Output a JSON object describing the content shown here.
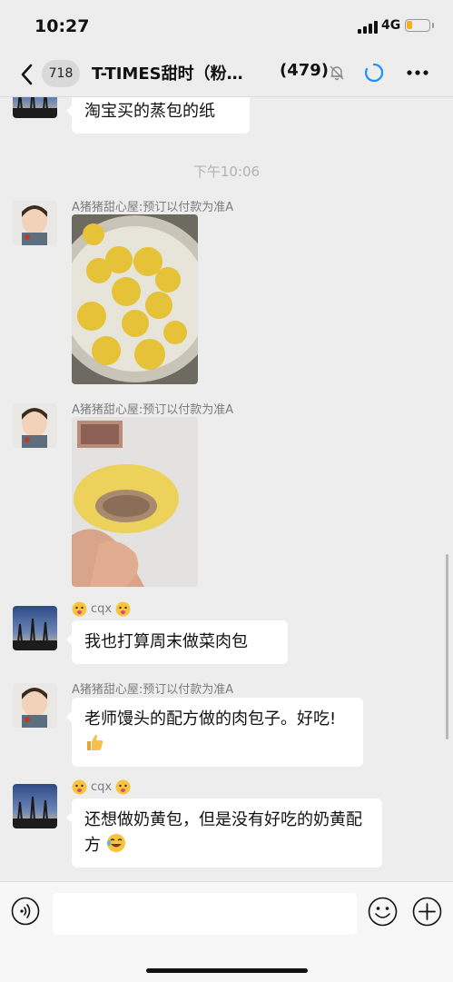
{
  "status_bar": {
    "time": "10:27",
    "network": "4G",
    "battery_level": 0.25
  },
  "header": {
    "unread_count": "718",
    "title": "T-TIMES甜时（粉…",
    "member_count": "(479)"
  },
  "messages": {
    "msg0": {
      "text": "淘宝买的蒸包的纸"
    },
    "timestamp": "下午10:06",
    "msg1": {
      "sender": "A猪猪甜心屋:预订以付款为准A"
    },
    "msg2": {
      "sender": "A猪猪甜心屋:预订以付款为准A"
    },
    "msg3": {
      "sender": "cqx",
      "text": "我也打算周末做菜肉包"
    },
    "msg4": {
      "sender": "A猪猪甜心屋:预订以付款为准A",
      "text": "老师馒头的配方做的肉包子。好吃!"
    },
    "msg5": {
      "sender": "cqx",
      "text": "还想做奶黄包，但是没有好吃的奶黄配方"
    }
  },
  "input_bar": {
    "placeholder": ""
  },
  "colors": {
    "background": "#ededed",
    "bubble": "#ffffff",
    "loading_accent": "#1e90ff",
    "battery_fill": "#f2b31e"
  }
}
